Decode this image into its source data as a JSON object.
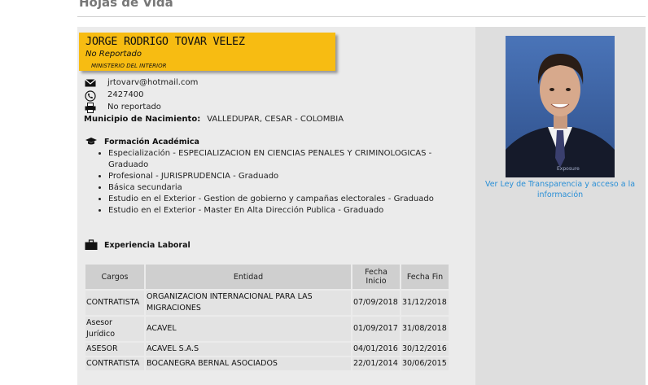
{
  "header": {
    "title": "Hojas de Vida"
  },
  "profile": {
    "name": "JORGE RODRIGO TOVAR VELEZ",
    "status": "No Reportado",
    "organization": "MINISTERIO DEL INTERIOR"
  },
  "contact": {
    "email": "jrtovarv@hotmail.com",
    "phone": "2427400",
    "fax": "No reportado",
    "email_icon": "envelope-icon",
    "phone_icon": "phone-icon",
    "fax_icon": "printer-icon"
  },
  "birth": {
    "label": "Municipio de Nacimiento:",
    "value": "VALLEDUPAR, CESAR - COLOMBIA"
  },
  "education": {
    "title": "Formación Académica",
    "icon": "graduation-cap-icon",
    "items": [
      "Especialización - ESPECIALIZACION EN CIENCIAS PENALES Y CRIMINOLOGICAS - Graduado",
      "Profesional - JURISPRUDENCIA - Graduado",
      "Básica secundaria",
      "Estudio en el Exterior - Gestion de gobierno y campañas electorales - Graduado",
      "Estudio en el Exterior - Master En Alta Dirección Publica - Graduado"
    ]
  },
  "experience": {
    "title": "Experiencia Laboral",
    "icon": "briefcase-icon",
    "columns": [
      "Cargos",
      "Entidad",
      "Fecha Inicio",
      "Fecha Fin"
    ],
    "rows": [
      [
        "CONTRATISTA",
        "ORGANIZACION INTERNACIONAL PARA LAS MIGRACIONES",
        "07/09/2018",
        "31/12/2018"
      ],
      [
        "Asesor Jurídico",
        "ACAVEL",
        "01/09/2017",
        "31/08/2018"
      ],
      [
        "ASESOR",
        "ACAVEL S.A.S",
        "04/01/2016",
        "30/12/2016"
      ],
      [
        "CONTRATISTA",
        "BOCANEGRA BERNAL ASOCIADOS",
        "22/01/2014",
        "30/06/2015"
      ]
    ]
  },
  "sidebar": {
    "link": "Ver Ley de Transparencia y acceso a la información",
    "photo_watermark": "Exposure"
  },
  "colors": {
    "card": "#f7bc12",
    "link": "#2a8fd6",
    "panel": "#ebebeb",
    "side_panel": "#dedede"
  }
}
